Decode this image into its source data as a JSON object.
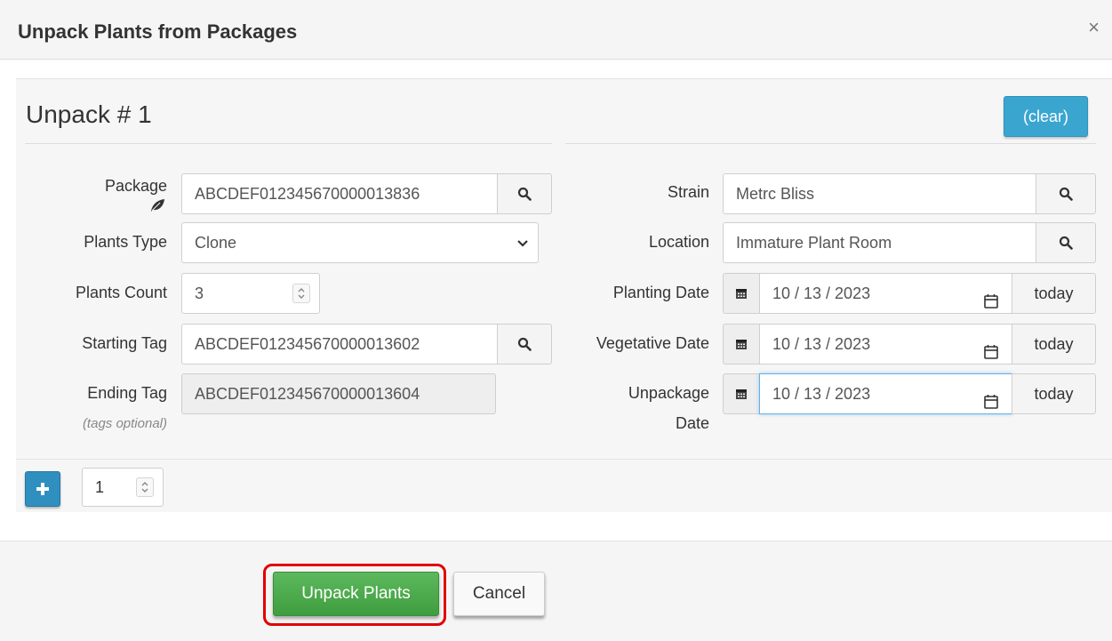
{
  "dialog": {
    "title": "Unpack Plants from Packages",
    "close_glyph": "×"
  },
  "section": {
    "title": "Unpack # 1",
    "clear_label": "(clear)"
  },
  "left": {
    "package_label": "Package",
    "package_value": "ABCDEF012345670000013836",
    "plants_type_label": "Plants Type",
    "plants_type_value": "Clone",
    "plants_count_label": "Plants Count",
    "plants_count_value": "3",
    "starting_tag_label": "Starting Tag",
    "starting_tag_value": "ABCDEF012345670000013602",
    "ending_tag_label": "Ending Tag",
    "ending_tag_value": "ABCDEF012345670000013604",
    "tags_optional": "(tags optional)"
  },
  "right": {
    "strain_label": "Strain",
    "strain_value": "Metrc Bliss",
    "location_label": "Location",
    "location_value": "Immature Plant Room",
    "planting_date_label": "Planting Date",
    "planting_date_value": "10 / 13 / 2023",
    "vegetative_date_label": "Vegetative Date",
    "vegetative_date_value": "10 / 13 / 2023",
    "unpackage_label_line1": "Unpackage",
    "unpackage_label_line2": "Date",
    "unpackage_date_value": "10 / 13 / 2023",
    "today_label": "today"
  },
  "add_row": {
    "count_value": "1"
  },
  "footer": {
    "primary_label": "Unpack Plants",
    "cancel_label": "Cancel"
  },
  "colors": {
    "primary": "#5cb85c",
    "info": "#3aa6d0",
    "highlight": "#e00000"
  }
}
